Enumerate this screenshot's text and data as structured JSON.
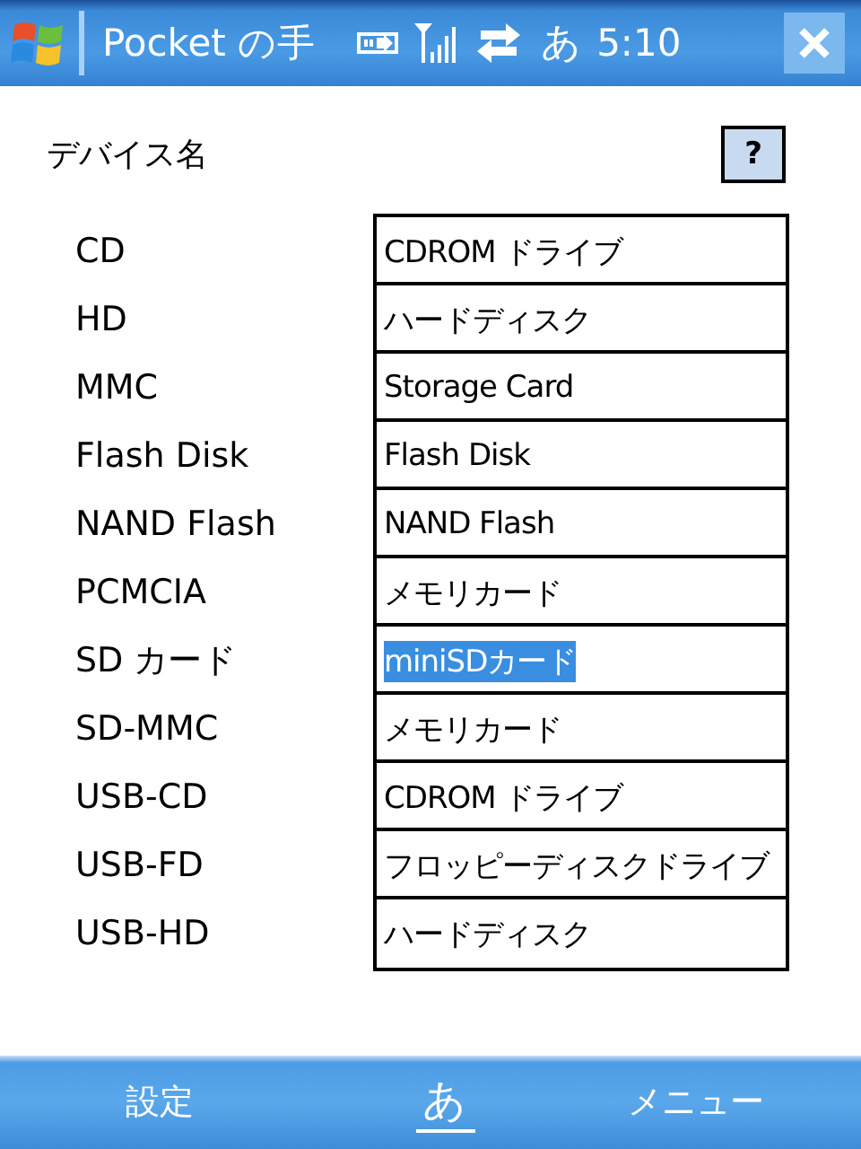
{
  "title_bar": {
    "title": "Pocket の手",
    "input_mode": "あ",
    "time": "5:10"
  },
  "heading": "デバイス名",
  "help_button": "?",
  "devices": [
    {
      "name": "CD",
      "value": "CDROM ドライブ",
      "selected": false
    },
    {
      "name": "HD",
      "value": "ハードディスク",
      "selected": false
    },
    {
      "name": "MMC",
      "value": "Storage Card",
      "selected": false
    },
    {
      "name": "Flash Disk",
      "value": "Flash Disk",
      "selected": false
    },
    {
      "name": "NAND Flash",
      "value": "NAND Flash",
      "selected": false
    },
    {
      "name": "PCMCIA",
      "value": "メモリカード",
      "selected": false
    },
    {
      "name": "SD カード",
      "value": "miniSDカード",
      "selected": true
    },
    {
      "name": "SD-MMC",
      "value": "メモリカード",
      "selected": false
    },
    {
      "name": "USB-CD",
      "value": "CDROM ドライブ",
      "selected": false
    },
    {
      "name": "USB-FD",
      "value": "フロッピーディスクドライブ",
      "selected": false
    },
    {
      "name": "USB-HD",
      "value": "ハードディスク",
      "selected": false
    }
  ],
  "menu_bar": {
    "left": "設定",
    "input_mode": "あ",
    "right": "メニュー"
  }
}
